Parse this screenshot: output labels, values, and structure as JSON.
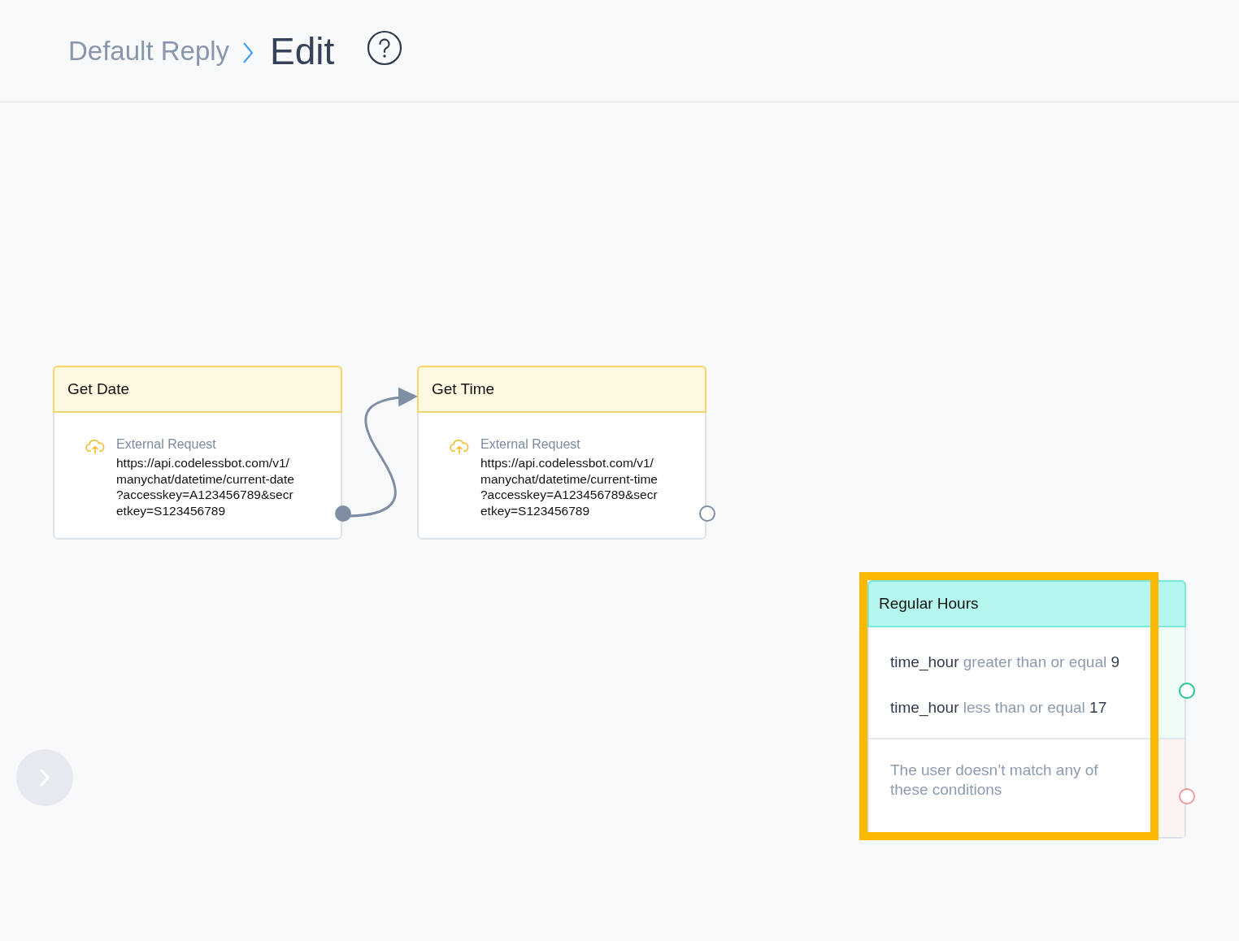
{
  "breadcrumb": {
    "parent": "Default Reply",
    "current": "Edit"
  },
  "nodes": [
    {
      "title": "Get Date",
      "action_label": "External Request",
      "url_lines": [
        "https://api.codelessbot.com/v1/",
        "manychat/datetime/current-date",
        "?accesskey=A123456789&secr",
        "etkey=S123456789"
      ],
      "connected": true
    },
    {
      "title": "Get Time",
      "action_label": "External Request",
      "url_lines": [
        "https://api.codelessbot.com/v1/",
        "manychat/datetime/current-time",
        "?accesskey=A123456789&secr",
        "etkey=S123456789"
      ],
      "connected": false
    }
  ],
  "condition_node": {
    "title": "Regular Hours",
    "highlighted": true,
    "branches": [
      {
        "kind": "conditions",
        "color": "#21c98a",
        "conditions": [
          {
            "field": "time_hour",
            "operator": "greater than or equal",
            "value": "9"
          },
          {
            "field": "time_hour",
            "operator": "less than or equal",
            "value": "17"
          }
        ]
      },
      {
        "kind": "fallback",
        "color": "#f49a9a",
        "text": "The user doesn’t match any of these conditions"
      }
    ]
  }
}
